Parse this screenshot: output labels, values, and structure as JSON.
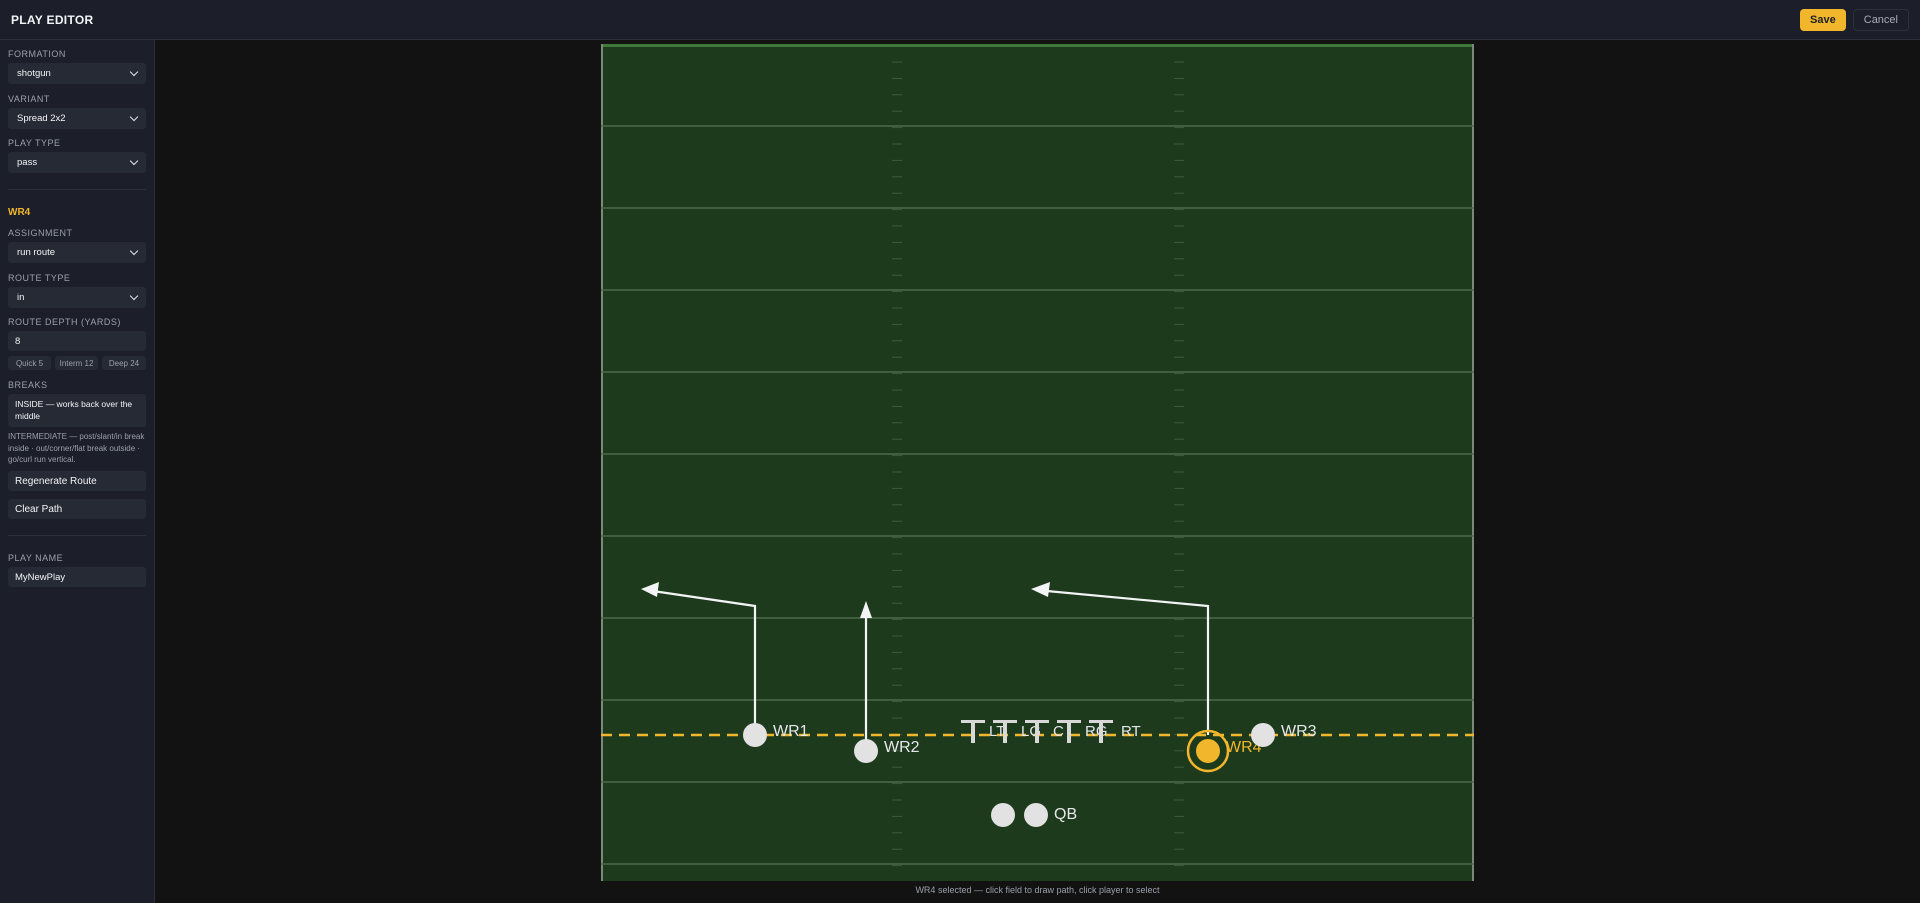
{
  "header": {
    "title": "PLAY EDITOR",
    "save_label": "Save",
    "cancel_label": "Cancel"
  },
  "sidebar": {
    "formation_label": "FORMATION",
    "formation_value": "shotgun",
    "variant_label": "VARIANT",
    "variant_value": "Spread 2x2",
    "playtype_label": "PLAY TYPE",
    "playtype_value": "pass",
    "selected_player": "WR4",
    "assignment_label": "ASSIGNMENT",
    "assignment_value": "run route",
    "routetype_label": "ROUTE TYPE",
    "routetype_value": "in",
    "depth_label": "ROUTE DEPTH (YARDS)",
    "depth_value": "8",
    "quick_buttons": [
      "Quick 5",
      "Interm 12",
      "Deep 24"
    ],
    "breaks_label": "BREAKS",
    "breaks_value": "INSIDE — works back over the middle",
    "breaks_hint": "INTERMEDIATE — post/slant/in break inside · out/corner/flat break outside · go/curl run vertical.",
    "regen_label": "Regenerate Route",
    "clear_label": "Clear Path",
    "playname_label": "PLAY NAME",
    "playname_value": "MyNewPlay"
  },
  "field": {
    "field_color": "#1e3a1c",
    "los_color": "#f1b62b",
    "selected_color": "#f1b62b",
    "players": [
      {
        "id": "WR1",
        "label": "WR1"
      },
      {
        "id": "WR2",
        "label": "WR2"
      },
      {
        "id": "WR4",
        "label": "WR4"
      },
      {
        "id": "WR3",
        "label": "WR3"
      },
      {
        "id": "RB",
        "label": ""
      },
      {
        "id": "QB",
        "label": "QB"
      }
    ],
    "linemen": [
      "LT",
      "LG",
      "C",
      "RG",
      "RT"
    ]
  },
  "status": "WR4 selected — click field to draw path, click player to select"
}
